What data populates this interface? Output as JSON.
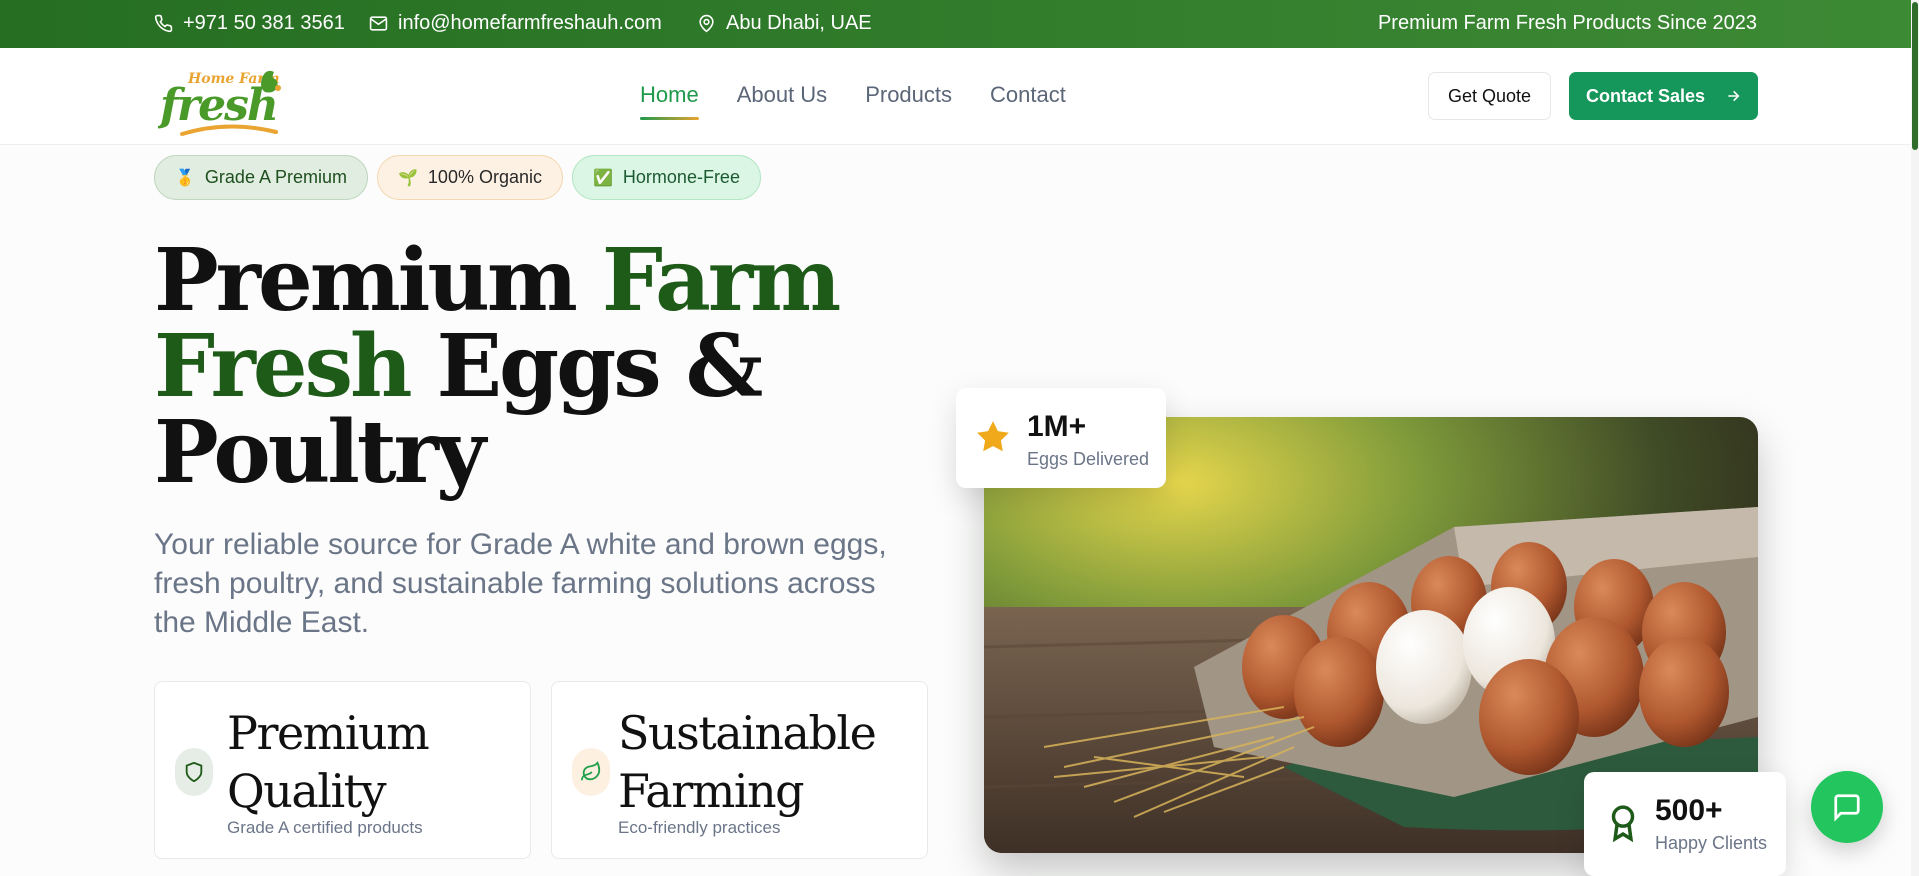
{
  "topbar": {
    "phone": "+971 50 381 3561",
    "email": "info@homefarmfreshauh.com",
    "location": "Abu Dhabi, UAE",
    "tagline": "Premium Farm Fresh Products Since 2023"
  },
  "logo": {
    "line1": "Home Farm",
    "line2": "fresh"
  },
  "nav": {
    "links": [
      "Home",
      "About Us",
      "Products",
      "Contact"
    ],
    "quote_label": "Get Quote",
    "sales_label": "Contact Sales"
  },
  "badges": [
    {
      "icon": "medal-icon",
      "label": "Grade A Premium"
    },
    {
      "icon": "seedling-icon",
      "label": "100% Organic"
    },
    {
      "icon": "check-box-icon",
      "label": "Hormone-Free"
    }
  ],
  "hero": {
    "title_1": "Premium ",
    "title_2": "Farm",
    "title_3": "Fresh",
    "title_4": " Eggs &",
    "title_5": "Poultry",
    "subtitle": "Your reliable source for Grade A white and brown eggs, fresh poultry, and sustainable farming solutions across the Middle East."
  },
  "features": [
    {
      "icon": "shield-icon",
      "title_1": "Premium",
      "title_2": "Quality",
      "subtitle": "Grade A certified products"
    },
    {
      "icon": "leaf-icon",
      "title_1": "Sustainable",
      "title_2": "Farming",
      "subtitle": "Eco-friendly practices"
    }
  ],
  "stats": [
    {
      "icon": "star-icon",
      "value": "1M+",
      "label": "Eggs Delivered"
    },
    {
      "icon": "award-icon",
      "value": "500+",
      "label": "Happy Clients"
    }
  ],
  "colors": {
    "brand_green": "#1e5a18",
    "accent_green": "#15965a",
    "chat_green": "#22c55e",
    "gold": "#e9a431"
  }
}
